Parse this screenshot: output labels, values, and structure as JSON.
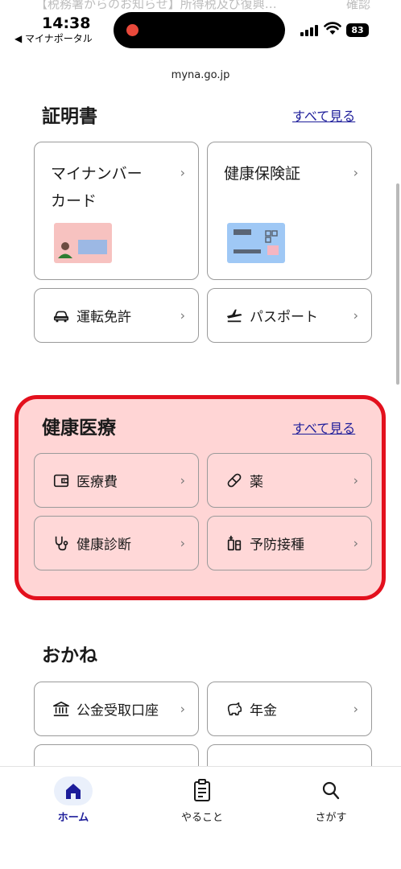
{
  "notification": {
    "text": "【税務署からのお知らせ】所得税及び復興…",
    "action": "確認"
  },
  "status_bar": {
    "time": "14:38",
    "back_app": "◀ マイナポータル",
    "battery": "83"
  },
  "browser": {
    "url": "myna.go.jp"
  },
  "certificates": {
    "title": "証明書",
    "see_all": "すべて見る",
    "cards": [
      {
        "label": "マイナンバーカード"
      },
      {
        "label": "健康保険証"
      },
      {
        "label": "運転免許",
        "icon": "car-icon"
      },
      {
        "label": "パスポート",
        "icon": "plane-icon"
      }
    ]
  },
  "health": {
    "title": "健康医療",
    "see_all": "すべて見る",
    "highlight_color": "#e3101d",
    "items": [
      {
        "label": "医療費",
        "icon": "wallet-icon"
      },
      {
        "label": "薬",
        "icon": "pill-icon"
      },
      {
        "label": "健康診断",
        "icon": "stethoscope-icon"
      },
      {
        "label": "予防接種",
        "icon": "vaccine-icon"
      }
    ]
  },
  "money": {
    "title": "おかね",
    "items": [
      {
        "label": "公金受取口座",
        "icon": "bank-icon"
      },
      {
        "label": "年金",
        "icon": "piggy-bank-icon"
      }
    ]
  },
  "tabs": [
    {
      "label": "ホーム",
      "icon": "home-icon",
      "active": true
    },
    {
      "label": "やること",
      "icon": "clipboard-icon",
      "active": false
    },
    {
      "label": "さがす",
      "icon": "search-icon",
      "active": false
    }
  ],
  "colors": {
    "accent": "#1d1d9a",
    "card_border": "#9a9a9a"
  }
}
